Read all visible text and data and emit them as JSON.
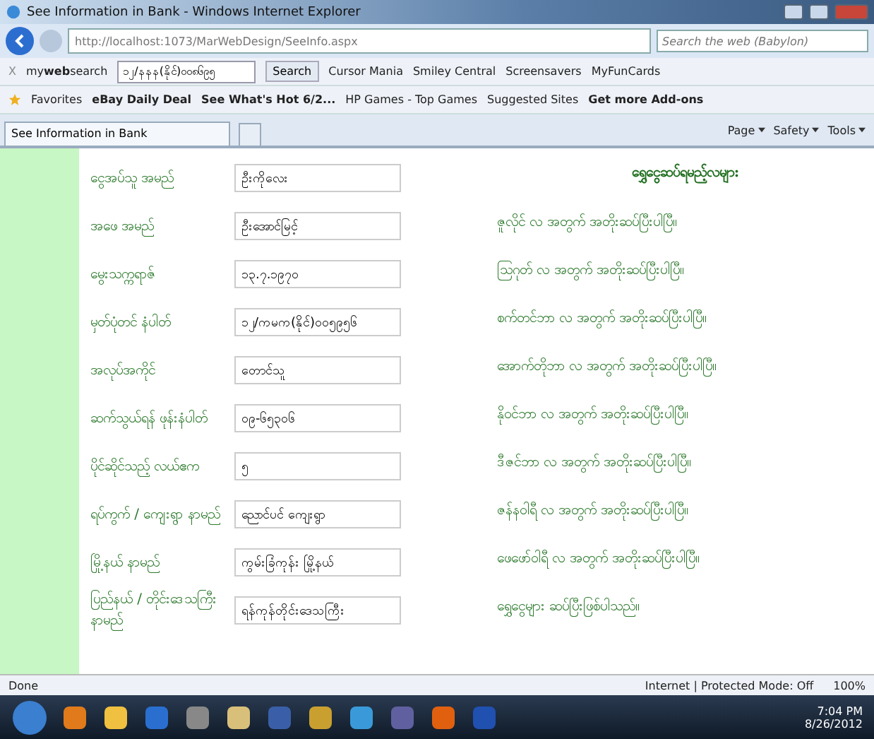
{
  "window": {
    "title": "See Information in Bank - Windows Internet Explorer"
  },
  "address_bar": {
    "url": "http://localhost:1073/MarWebDesign/SeeInfo.aspx",
    "search_placeholder": "Search the web (Babylon)"
  },
  "search_toolbar": {
    "close": "X",
    "brand": "my**web**search",
    "value": "၁၂/နနန(နိုင်)၀၀၈၆၉၅",
    "search_button": "Search",
    "links": [
      "Cursor Mania",
      "Smiley Central",
      "Screensavers",
      "MyFunCards"
    ]
  },
  "favorites_bar": {
    "label": "Favorites",
    "links": [
      {
        "label": "eBay Daily Deal",
        "bold": true
      },
      {
        "label": "See What's Hot 6/2...",
        "bold": true
      },
      {
        "label": "HP Games - Top Games",
        "bold": false
      },
      {
        "label": "Suggested Sites",
        "bold": false
      },
      {
        "label": "Get more Add-ons",
        "bold": true
      }
    ]
  },
  "tab": {
    "label": "See Information in Bank"
  },
  "command_bar": [
    "Page",
    "Safety",
    "Tools"
  ],
  "form": [
    {
      "label": "ငွေအပ်သူ အမည်",
      "value": "ဦးကိုလေး"
    },
    {
      "label": "အဖေ အမည်",
      "value": "ဦးအောင်မြင့်"
    },
    {
      "label": "မွေးသက္ကရာဇ်",
      "value": "၁၃.၇.၁၉၇၀"
    },
    {
      "label": "မှတ်ပုံတင် နံပါတ်",
      "value": "၁၂/ကမက(နိုင်)၀၀၅၉၅၆"
    },
    {
      "label": "အလုပ်အကိုင်",
      "value": "တောင်သူ"
    },
    {
      "label": "ဆက်သွယ်ရန် ဖုန်းနံပါတ်",
      "value": "၀၉-၆၅၃၀၆"
    },
    {
      "label": "ပိုင်ဆိုင်သည့် လယ်ဧက",
      "value": "၅"
    },
    {
      "label": "ရပ်ကွက် / ကျေးရွာ နာမည်",
      "value": "ညောင်ပင် ကျေးရွာ"
    },
    {
      "label": "မြို့နယ် နာမည်",
      "value": "ကွမ်းခြံကုန်း မြို့နယ်"
    },
    {
      "label": "ပြည်နယ် / တိုင်းဒေသကြီး နာမည်",
      "value": "ရန်ကုန်တိုင်းဒေသကြီး"
    }
  ],
  "payments": {
    "title": "ရွှေငွေဆပ်ရမည့်လများ",
    "items": [
      "ဇူလိုင် လ အတွက် အတိုးဆပ်ပြီးပါပြီ။",
      "ဩဂုတ် လ အတွက် အတိုးဆပ်ပြီးပါပြီ။",
      "စက်တင်ဘာ လ အတွက် အတိုးဆပ်ပြီးပါပြီ။",
      "အောက်တိုဘာ လ အတွက် အတိုးဆပ်ပြီးပါပြီ။",
      "နိုဝင်ဘာ လ အတွက် အတိုးဆပ်ပြီးပါပြီ။",
      "ဒီဇင်ဘာ လ အတွက် အတိုးဆပ်ပြီးပါပြီ။",
      "ဇန်နဝါရီ လ အတွက် အတိုးဆပ်ပြီးပါပြီ။",
      "ဖေဖော်ဝါရီ လ အတွက် အတိုးဆပ်ပြီးပါပြီ။",
      "ရွှေငွေများ ဆပ်ပြီးဖြစ်ပါသည်။"
    ]
  },
  "status_bar": {
    "text": "Done",
    "zone": "Internet | Protected Mode: Off",
    "zoom": "100%"
  },
  "taskbar": {
    "time": "7:04 PM",
    "date": "8/26/2012"
  }
}
